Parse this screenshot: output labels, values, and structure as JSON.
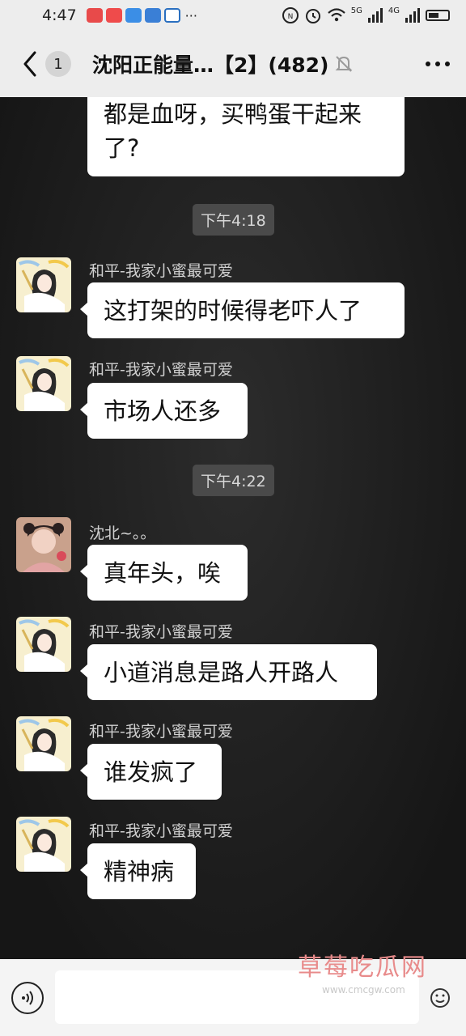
{
  "status_bar": {
    "time": "4:47",
    "more": "···",
    "network_1": "5G",
    "network_2": "4G",
    "battery_level": 0.55
  },
  "header": {
    "unread_count": "1",
    "title": "沈阳正能量…【2】(482)"
  },
  "messages": [
    {
      "type": "text",
      "text_line1": "都是血呀，买鸭蛋干起来",
      "text_line2": "了?"
    },
    {
      "type": "time",
      "text": "下午4:18"
    },
    {
      "type": "text",
      "sender": "和平-我家小蜜最可爱",
      "text": "这打架的时候得老吓人了"
    },
    {
      "type": "text",
      "sender": "和平-我家小蜜最可爱",
      "text": "市场人还多"
    },
    {
      "type": "time",
      "text": "下午4:22"
    },
    {
      "type": "text",
      "sender": "沈北~。。",
      "text": "真年头，唉"
    },
    {
      "type": "text",
      "sender": "和平-我家小蜜最可爱",
      "text": "小道消息是路人开路人"
    },
    {
      "type": "text",
      "sender": "和平-我家小蜜最可爱",
      "text": "谁发疯了"
    },
    {
      "type": "text",
      "sender": "和平-我家小蜜最可爱",
      "text": "精神病"
    }
  ],
  "watermark": {
    "main": "草莓吃瓜网",
    "sub": "www.cmcgw.com"
  },
  "colors": {
    "chat_background": "#1d1d1d",
    "bubble": "#ffffff",
    "bar_background": "#ededed",
    "timestamp_background": "#4a4a4a"
  }
}
